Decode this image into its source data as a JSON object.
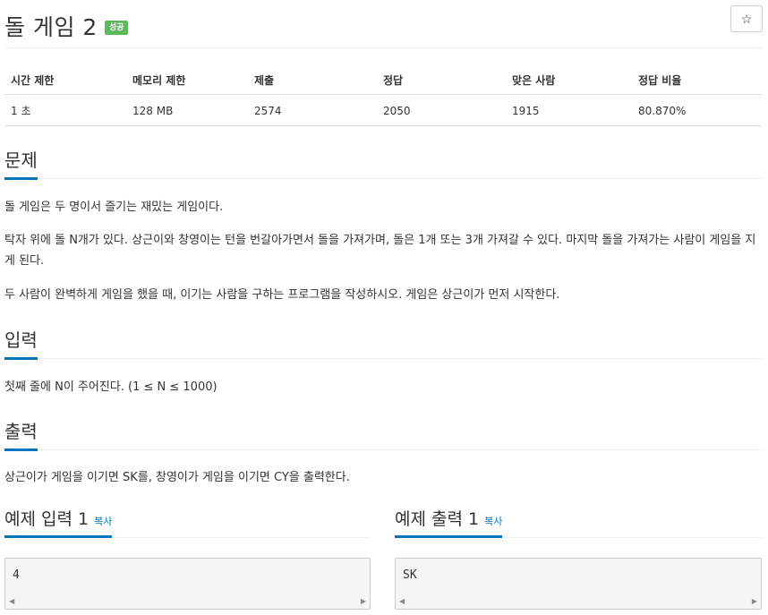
{
  "problem": {
    "title": "돌 게임 2",
    "status_badge": "성공",
    "star_icon": "☆"
  },
  "info_table": {
    "headers": [
      "시간 제한",
      "메모리 제한",
      "제출",
      "정답",
      "맞은 사람",
      "정답 비율"
    ],
    "values": [
      "1 초",
      "128 MB",
      "2574",
      "2050",
      "1915",
      "80.870%"
    ]
  },
  "sections": {
    "problem": {
      "heading": "문제",
      "paragraphs": [
        "돌 게임은 두 명이서 즐기는 재밌는 게임이다.",
        "탁자 위에 돌 N개가 있다. 상근이와 창영이는 턴을 번갈아가면서 돌을 가져가며, 돌은 1개 또는 3개 가져갈 수 있다. 마지막 돌을 가져가는 사람이 게임을 지게 된다.",
        "두 사람이 완벽하게 게임을 했을 때, 이기는 사람을 구하는 프로그램을 작성하시오. 게임은 상근이가 먼저 시작한다."
      ]
    },
    "input": {
      "heading": "입력",
      "text": "첫째 줄에 N이 주어진다. (1 ≤ N ≤ 1000)"
    },
    "output": {
      "heading": "출력",
      "text": "상근이가 게임을 이기면 SK를, 창영이가 게임을 이기면 CY을 출력한다."
    }
  },
  "samples": {
    "input": {
      "heading": "예제 입력 1",
      "copy_label": "복사",
      "content": "4"
    },
    "output": {
      "heading": "예제 출력 1",
      "copy_label": "복사",
      "content": "SK"
    }
  },
  "scroll_arrows": {
    "left": "◀",
    "right": "▶"
  }
}
